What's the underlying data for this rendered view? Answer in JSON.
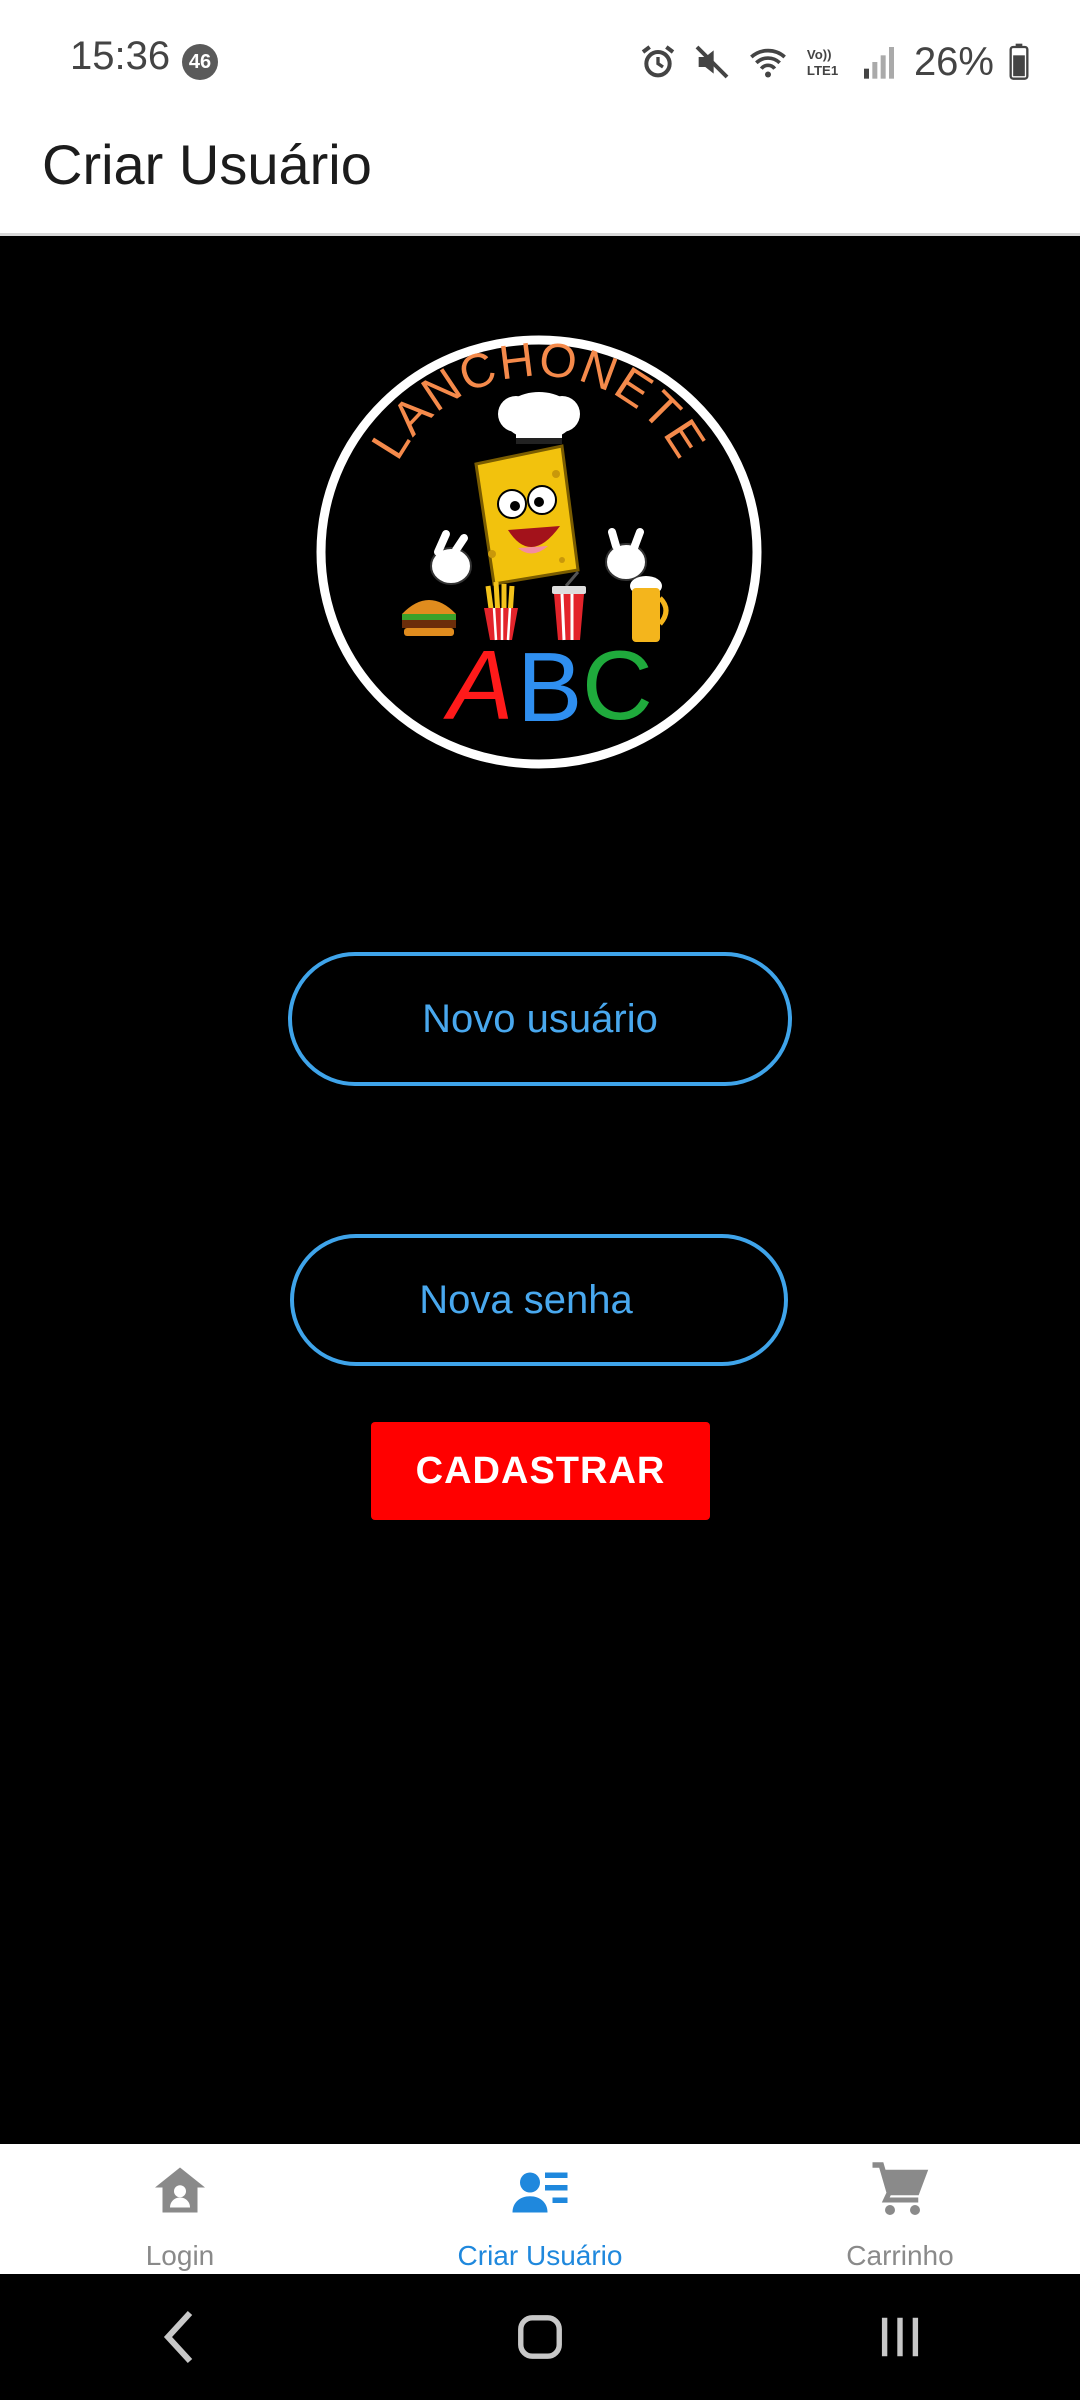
{
  "status_bar": {
    "time": "15:36",
    "notification_count": "46",
    "battery_percent": "26%"
  },
  "app_bar": {
    "title": "Criar Usuário"
  },
  "logo": {
    "arc_text": "LANCHONETE",
    "letters": [
      "A",
      "B",
      "C"
    ],
    "letter_colors": [
      "#ff1a1a",
      "#2f8ff0",
      "#1faa3c"
    ],
    "arc_color": "#f58a4b"
  },
  "form": {
    "username_placeholder": "Novo usuário",
    "password_placeholder": "Nova senha",
    "submit_label": "CADASTRAR"
  },
  "bottom_nav": {
    "items": [
      {
        "label": "Login",
        "icon": "home-icon",
        "active": false
      },
      {
        "label": "Criar Usuário",
        "icon": "user-list-icon",
        "active": true
      },
      {
        "label": "Carrinho",
        "icon": "cart-icon",
        "active": false
      }
    ]
  },
  "colors": {
    "accent": "#1f88dd",
    "input_border": "#3fa4ea",
    "button": "#ff0000",
    "background": "#000000"
  }
}
